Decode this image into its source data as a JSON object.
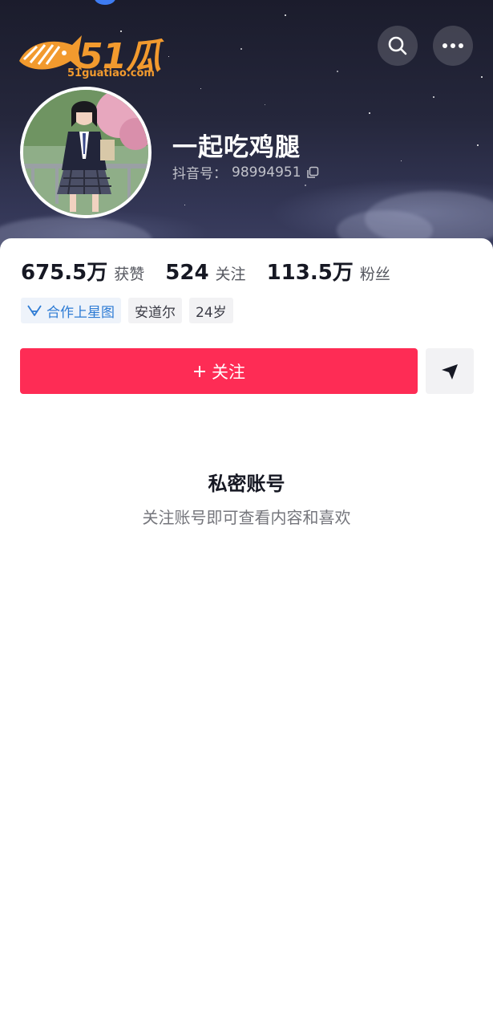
{
  "watermark": {
    "brand": "51瓜条",
    "domain": "51guatiao.com",
    "color": "#f29a2e"
  },
  "header": {
    "search_icon": "search-icon",
    "more_icon": "more-dots-icon"
  },
  "profile": {
    "nickname": "一起吃鸡腿",
    "douyin_id_label": "抖音号：",
    "douyin_id": "98994951",
    "copy_icon": "copy-icon"
  },
  "stats": [
    {
      "value": "675.5万",
      "label": "获赞"
    },
    {
      "value": "524",
      "label": "关注"
    },
    {
      "value": "113.5万",
      "label": "粉丝"
    }
  ],
  "tags": [
    {
      "label": "合作上星图",
      "icon": "xingtu-icon"
    },
    {
      "label": "安道尔"
    },
    {
      "label": "24岁"
    }
  ],
  "actions": {
    "follow_label": "关注",
    "follow_icon": "plus-icon",
    "share_icon": "send-icon",
    "accent": "#fe2c55"
  },
  "private": {
    "title": "私密账号",
    "description": "关注账号即可查看内容和喜欢"
  }
}
